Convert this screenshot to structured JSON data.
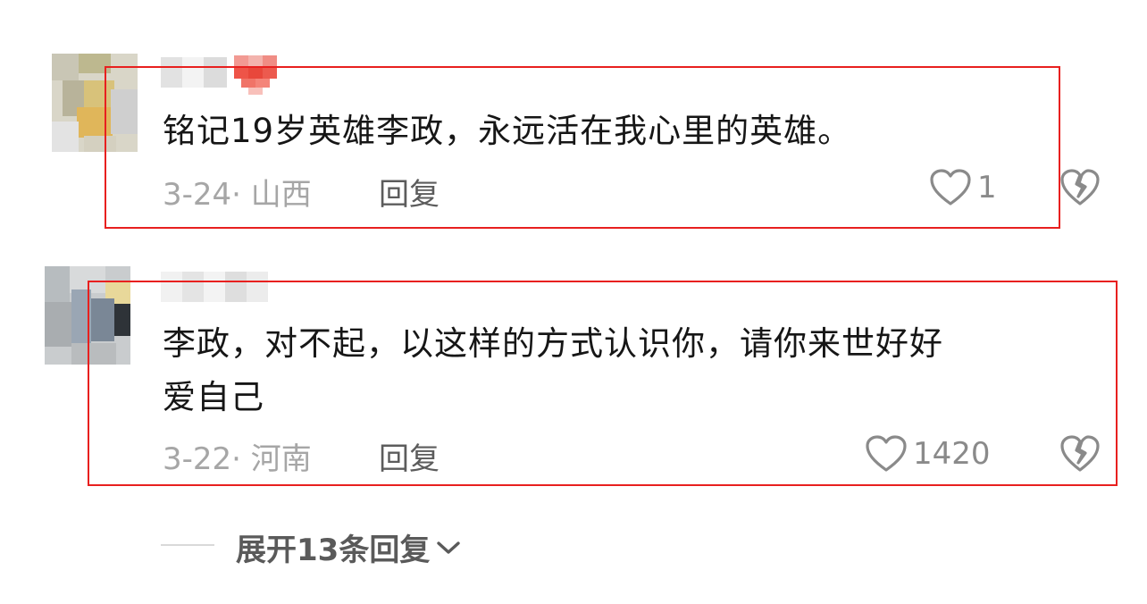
{
  "comments": [
    {
      "text": "铭记19岁英雄李政，永远活在我心里的英雄。",
      "date_region": "3-24· 山西",
      "reply_label": "回复",
      "like_count": "1"
    },
    {
      "text_line1": "李政，对不起，以这样的方式认识你，请你来世好好",
      "text_line2": "爱自己",
      "date_region": "3-22· 河南",
      "reply_label": "回复",
      "like_count": "1420"
    }
  ],
  "expand": {
    "label": "展开13条回复"
  },
  "colors": {
    "highlight_border": "#e8201f",
    "text": "#161616",
    "meta": "#a6a6a6",
    "reply": "#5c5c5c",
    "icon": "#8a8a8a"
  }
}
